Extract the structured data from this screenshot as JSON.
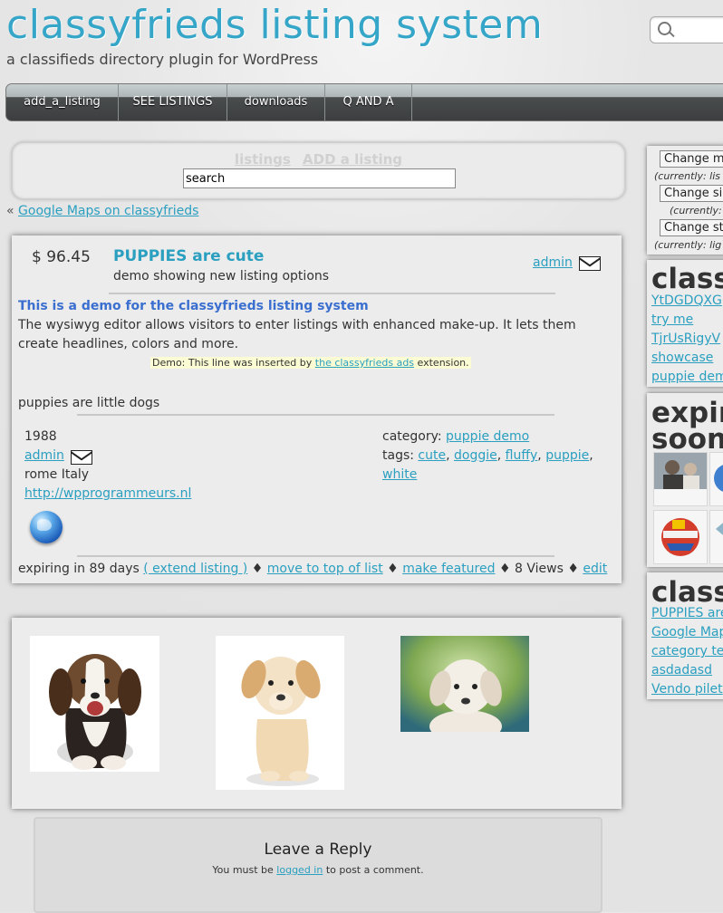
{
  "site": {
    "title": "classyfrieds listing system",
    "tagline": "a classifieds directory plugin for WordPress"
  },
  "nav": {
    "items": [
      {
        "label": "add_a_listing"
      },
      {
        "label": "SEE LISTINGS"
      },
      {
        "label": "downloads"
      },
      {
        "label": "Q AND A"
      }
    ]
  },
  "search_panel": {
    "link_listings": "listings",
    "link_add": "ADD a listing",
    "search_value": "search"
  },
  "back_link": {
    "prefix": "«",
    "label": "Google Maps on classyfrieds"
  },
  "listing": {
    "price": "$ 96.45",
    "title": "PUPPIES are cute",
    "subtitle": "demo showing new listing options",
    "author": "admin",
    "demo_heading": "This is a demo for the classyfrieds listing system",
    "demo_body": "The wysiwyg editor allows visitors to enter listings with enhanced make-up. It lets them create headlines, colors and more.",
    "inserted_prefix": "Demo: This line was inserted by",
    "inserted_link": "the classyfrieds ads",
    "inserted_suffix": "extension.",
    "description": "puppies are little dogs",
    "year": "1988",
    "author_small": "admin",
    "location": "rome Italy",
    "website": "http://wpprogrammeurs.nl",
    "category_label": "category:",
    "category_value": "puppie demo",
    "tags_label": "tags:",
    "tags": [
      "cute",
      "doggie",
      "fluffy",
      "puppie",
      "white"
    ],
    "footer": {
      "expiring": "expiring in 89 days",
      "extend": "( extend listing )",
      "move_top": "move to top of list",
      "featured": "make featured",
      "views": "8 Views",
      "edit": "edit",
      "separator": "♦"
    }
  },
  "reply": {
    "title": "Leave a Reply",
    "prefix": "You must be",
    "link": "logged in",
    "suffix": "to post a comment."
  },
  "sidebar": {
    "changes": [
      {
        "button": "Change m",
        "currently": "(currently: lis"
      },
      {
        "button": "Change si",
        "currently": "(currently:"
      },
      {
        "button": "Change st",
        "currently": "(currently: lig"
      }
    ],
    "classifieds_head": "class",
    "classifieds_links": [
      "YtDGDQXG",
      "try me",
      "TjrUsRigyV",
      "showcase",
      "puppie dem"
    ],
    "expiring_head_1": "expir",
    "expiring_head_2": "soon",
    "recent_head": "class",
    "recent_links": [
      "PUPPIES are",
      "Google Map",
      "category te",
      "asdadasd",
      "Vendo pilet"
    ]
  },
  "search_top": {
    "placeholder": ""
  },
  "colors": {
    "link": "#2a9fc0",
    "title": "#35a6c8",
    "demo_heading": "#3a6fd0"
  }
}
